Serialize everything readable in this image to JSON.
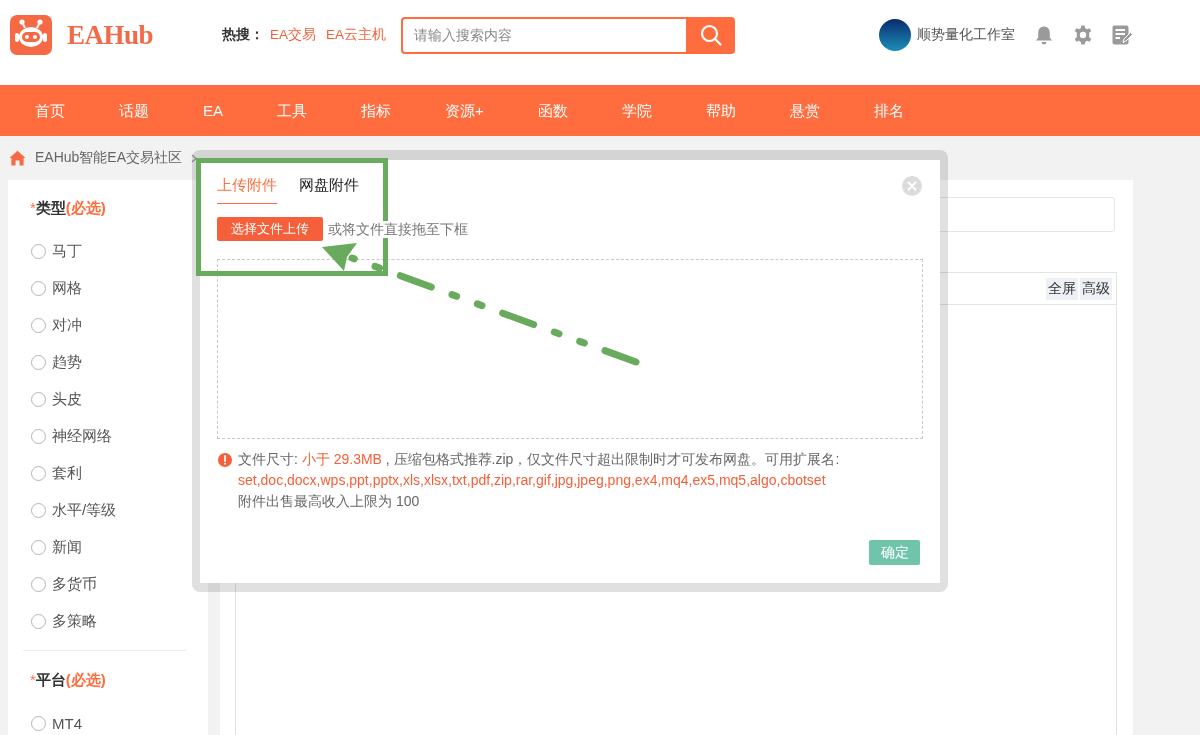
{
  "header": {
    "logo": "EAHub",
    "hot_search": {
      "label": "热搜：",
      "links": [
        "EA交易",
        "EA云主机"
      ]
    },
    "search": {
      "placeholder": "请输入搜索内容"
    },
    "user": {
      "name": "顺势量化工作室"
    }
  },
  "nav": [
    "首页",
    "话题",
    "EA",
    "工具",
    "指标",
    "资源+",
    "函数",
    "学院",
    "帮助",
    "悬赏",
    "排名"
  ],
  "breadcrumb": [
    "EAHub智能EA交易社区"
  ],
  "sidebar": {
    "groups": [
      {
        "asterisk": "*",
        "title": "类型",
        "note": "(必选)",
        "options": [
          {
            "label": "马丁",
            "selected": false
          },
          {
            "label": "网格",
            "selected": false
          },
          {
            "label": "对冲",
            "selected": false
          },
          {
            "label": "趋势",
            "selected": false
          },
          {
            "label": "头皮",
            "selected": false
          },
          {
            "label": "神经网络",
            "selected": false
          },
          {
            "label": "套利",
            "selected": false
          },
          {
            "label": "水平/等级",
            "selected": false
          },
          {
            "label": "新闻",
            "selected": false
          },
          {
            "label": "多货币",
            "selected": false
          },
          {
            "label": "多策略",
            "selected": false
          }
        ]
      },
      {
        "asterisk": "*",
        "title": "平台",
        "note": "(必选)",
        "options": [
          {
            "label": "MT4",
            "selected": false
          }
        ]
      }
    ]
  },
  "editor": {
    "toolbar_buttons": [
      "全屏",
      "高级"
    ]
  },
  "modal": {
    "tabs": [
      {
        "label": "上传附件",
        "selected": true
      },
      {
        "label": "网盘附件",
        "selected": false
      }
    ],
    "upload_button": "选择文件上传",
    "drop_hint": "或将文件直接拖至下框",
    "notice": {
      "size_label": "文件尺寸:",
      "size_limit": "小于 29.3MB",
      "size_note": ", 压缩包格式推荐.zip，仅文件尺寸超出限制时才可发布网盘。可用扩展名:",
      "extensions": "set,doc,docx,wps,ppt,pptx,xls,xlsx,txt,pdf,zip,rar,gif,jpg,jpeg,png,ex4,mq4,ex5,mq5,algo,cbotset",
      "sale_limit": "附件出售最高收入上限为 100"
    },
    "confirm_button": "确定"
  }
}
